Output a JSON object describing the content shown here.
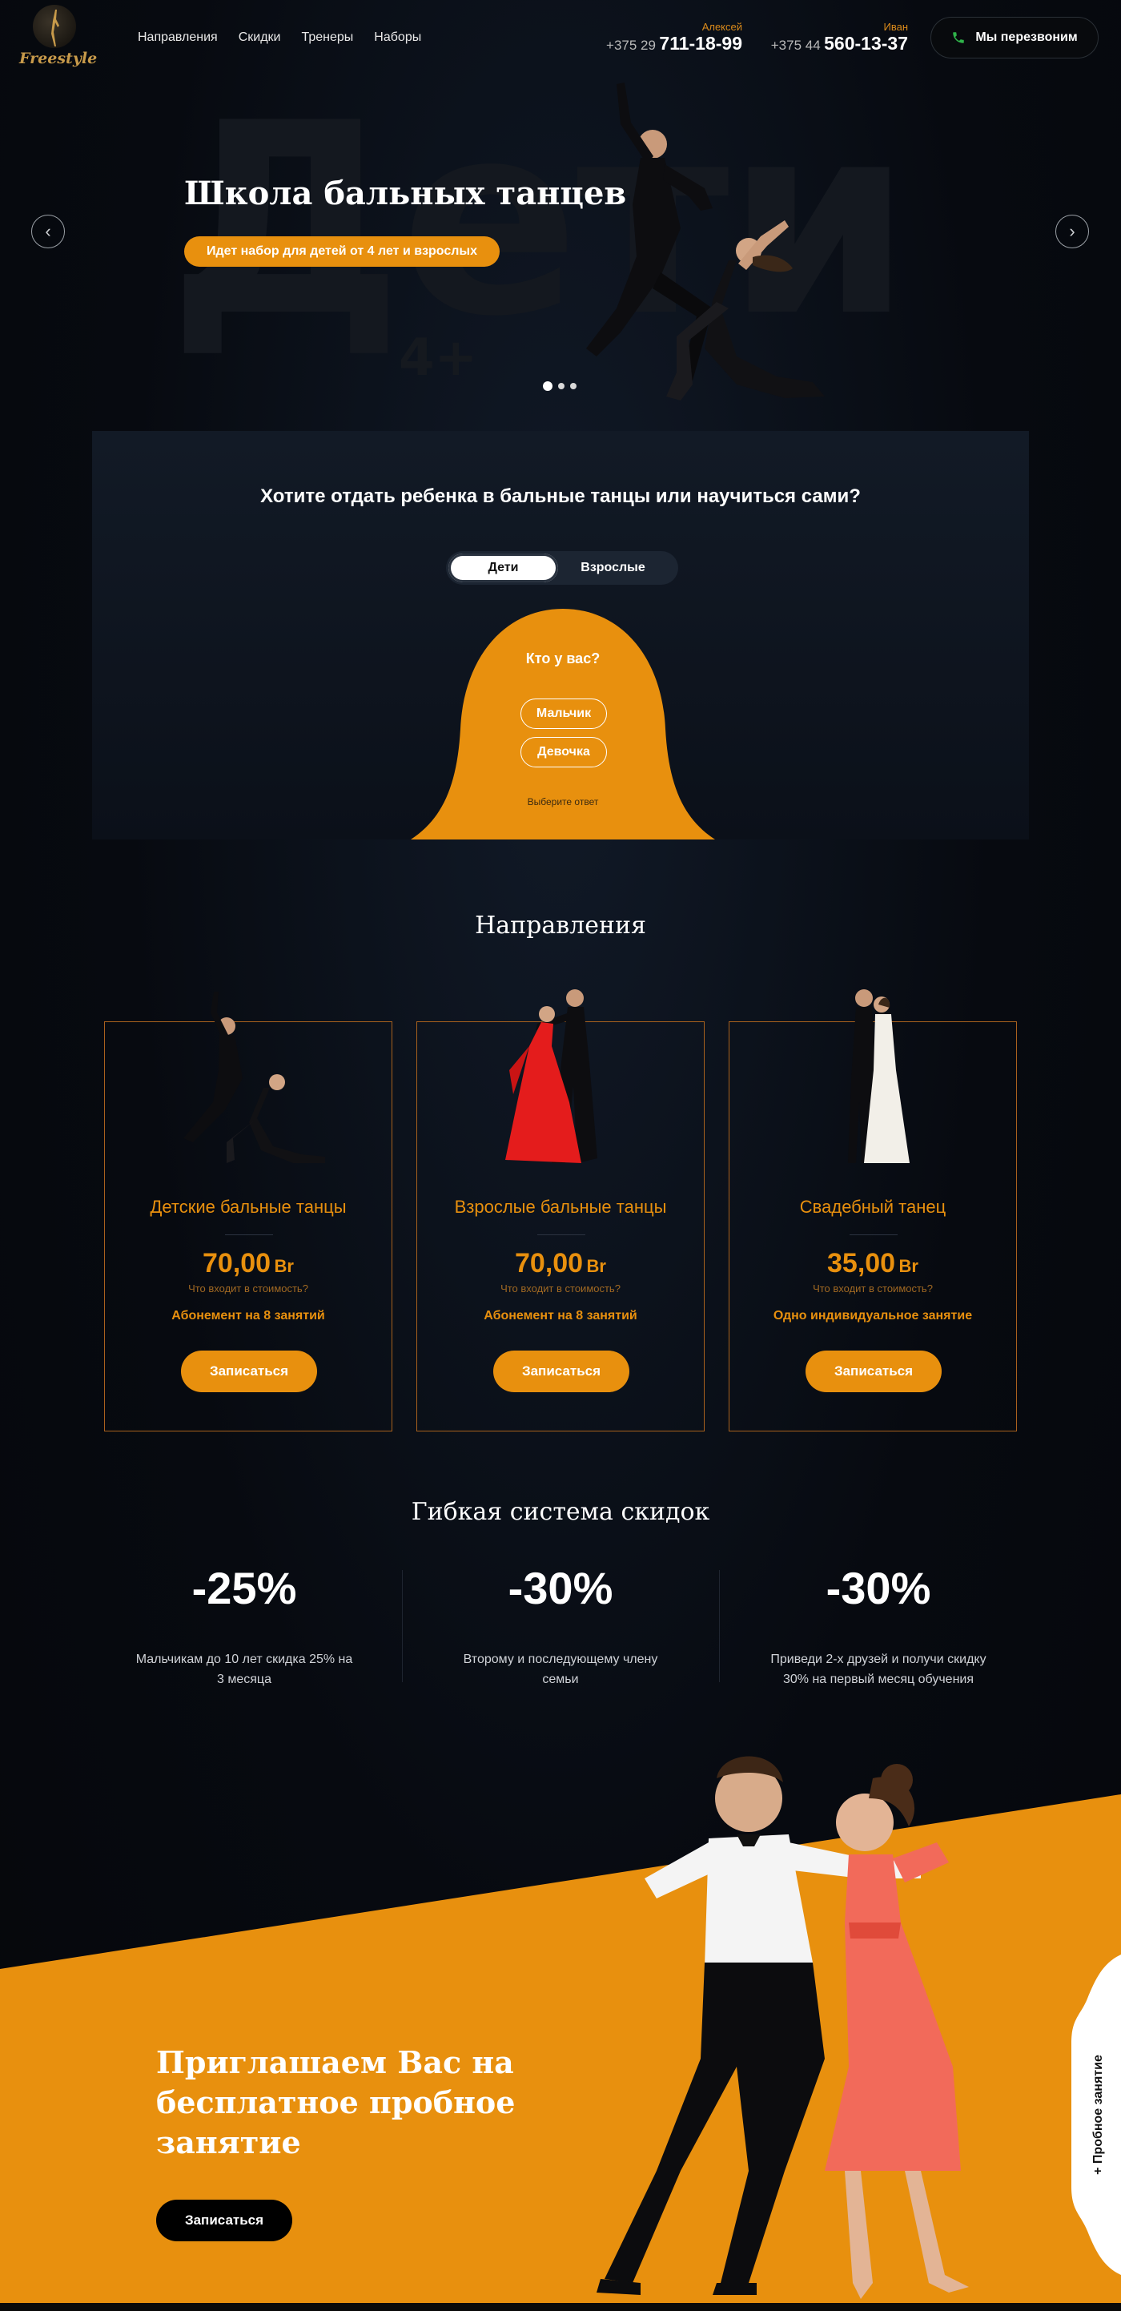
{
  "header": {
    "logo_text": "Freestyle",
    "nav": [
      "Направления",
      "Скидки",
      "Тренеры",
      "Наборы"
    ],
    "phones": [
      {
        "name": "Алексей",
        "code": "+375 29",
        "number": "711-18-99"
      },
      {
        "name": "Иван",
        "code": "+375 44",
        "number": "560-13-37"
      }
    ],
    "callback_label": "Мы перезвоним"
  },
  "hero": {
    "bg_word": "Дети",
    "bg_age": "4+",
    "title": "Школа бальных танцев",
    "badge": "Идет набор для детей от 4 лет и взрослых",
    "prev_icon": "‹",
    "next_icon": "›",
    "slides_count": 3,
    "active_slide": 1
  },
  "quiz": {
    "title": "Хотите отдать ребенка в бальные танцы или научиться сами?",
    "tabs": [
      "Дети",
      "Взрослые"
    ],
    "active_tab": "Дети",
    "question": "Кто у вас?",
    "options": [
      "Мальчик",
      "Девочка"
    ],
    "hint": "Выберите ответ"
  },
  "directions": {
    "title": "Направления",
    "cards": [
      {
        "name": "Детские бальные танцы",
        "price": "70,00",
        "currency": "Br",
        "includes": "Что входит в стоимость?",
        "sub": "Абонемент на 8 занятий",
        "button": "Записаться"
      },
      {
        "name": "Взрослые бальные танцы",
        "price": "70,00",
        "currency": "Br",
        "includes": "Что входит в стоимость?",
        "sub": "Абонемент на 8 занятий",
        "button": "Записаться"
      },
      {
        "name": "Свадебный танец",
        "price": "35,00",
        "currency": "Br",
        "includes": "Что входит в стоимость?",
        "sub": "Одно индивидуальное занятие",
        "button": "Записаться"
      }
    ]
  },
  "discounts": {
    "title": "Гибкая система скидок",
    "items": [
      {
        "pct": "-25%",
        "line1": "Мальчикам до 10 лет скидка 25% на",
        "line2": "3 месяца"
      },
      {
        "pct": "-30%",
        "line1": "Второму и последующему члену",
        "line2": "семьи"
      },
      {
        "pct": "-30%",
        "line1": "Приведи 2-х друзей и получи скидку",
        "line2": "30% на первый месяц обучения"
      }
    ]
  },
  "promo": {
    "title_lines": [
      "Приглашаем Вас на",
      "бесплатное пробное",
      "занятие"
    ],
    "button": "Записаться",
    "side_tab": "+ Пробное занятие"
  },
  "colors": {
    "accent": "#e8900e",
    "background": "#05070c",
    "card_border": "#a8611d"
  }
}
